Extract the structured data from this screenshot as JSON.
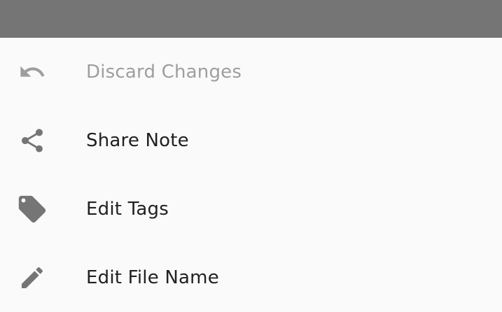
{
  "menu": {
    "items": [
      {
        "label": "Discard Changes",
        "icon": "undo-icon",
        "enabled": false
      },
      {
        "label": "Share Note",
        "icon": "share-icon",
        "enabled": true
      },
      {
        "label": "Edit Tags",
        "icon": "tag-icon",
        "enabled": true
      },
      {
        "label": "Edit File Name",
        "icon": "pencil-icon",
        "enabled": true
      }
    ]
  },
  "colors": {
    "scrim": "#757575",
    "sheet_background": "#fafafa",
    "text_primary": "#212121",
    "text_disabled": "#9e9e9e",
    "icon": "#757575"
  }
}
